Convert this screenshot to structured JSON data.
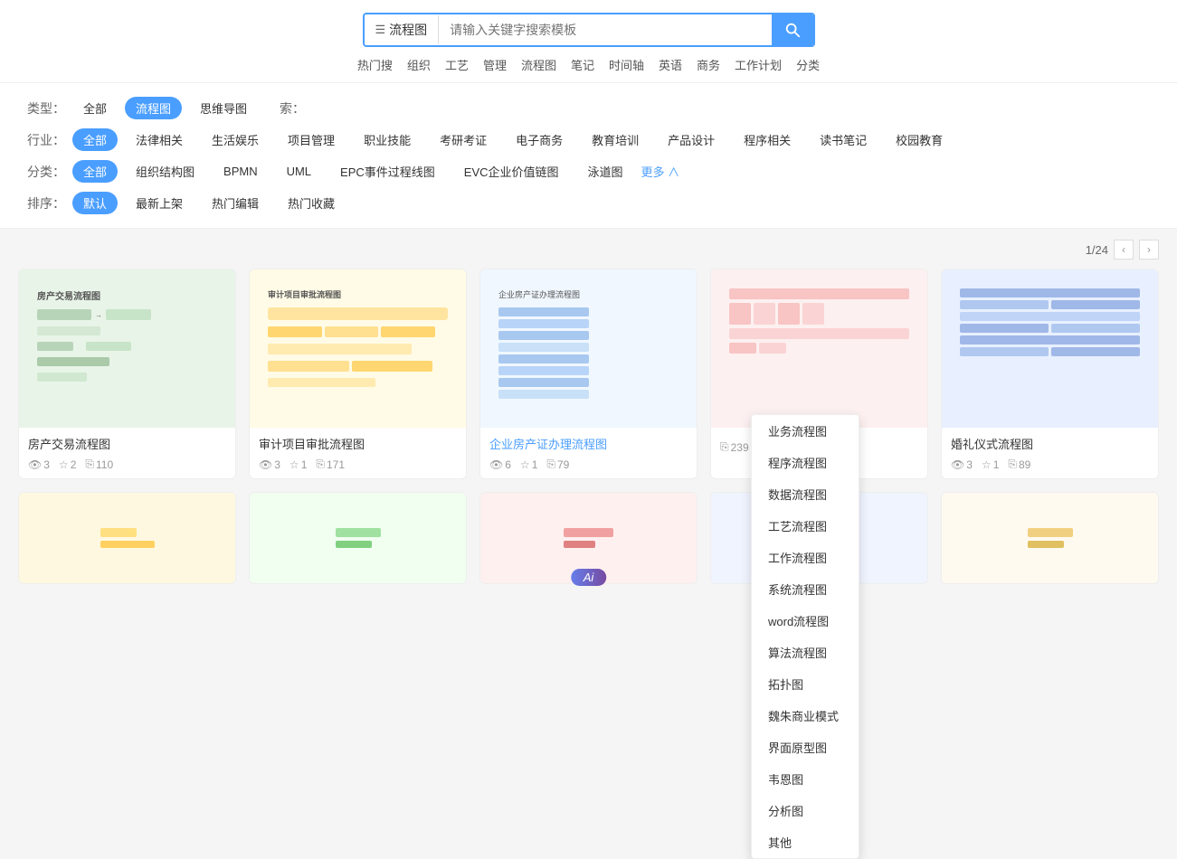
{
  "search": {
    "type_label": "流程图",
    "placeholder": "请输入关键字搜索模板",
    "button_label": "🔍"
  },
  "hot_tags": [
    "热门搜",
    "组织",
    "工艺",
    "管理",
    "流程图",
    "笔记",
    "时间轴",
    "英语",
    "商务",
    "工作计划",
    "分类"
  ],
  "filters": {
    "type_label": "类型：",
    "type_tags": [
      {
        "label": "全部",
        "active": false
      },
      {
        "label": "流程图",
        "active": true
      },
      {
        "label": "思维导图",
        "active": false
      }
    ],
    "search_label": "索：",
    "industry_label": "行业：",
    "industry_tags": [
      {
        "label": "全部",
        "active": true
      },
      {
        "label": "法律相关",
        "active": false
      },
      {
        "label": "生活娱乐",
        "active": false
      },
      {
        "label": "项目管理",
        "active": false
      },
      {
        "label": "职业技能",
        "active": false
      },
      {
        "label": "考研考证",
        "active": false
      },
      {
        "label": "电子商务",
        "active": false
      },
      {
        "label": "教育培训",
        "active": false
      },
      {
        "label": "产品设计",
        "active": false
      },
      {
        "label": "程序相关",
        "active": false
      },
      {
        "label": "读书笔记",
        "active": false
      },
      {
        "label": "校园教育",
        "active": false
      }
    ],
    "category_label": "分类：",
    "category_tags": [
      {
        "label": "全部",
        "active": true
      },
      {
        "label": "组织结构图",
        "active": false
      },
      {
        "label": "BPMN",
        "active": false
      },
      {
        "label": "UML",
        "active": false
      },
      {
        "label": "EPC事件过程线图",
        "active": false
      },
      {
        "label": "EVC企业价值链图",
        "active": false
      },
      {
        "label": "泳道图",
        "active": false
      }
    ],
    "more_label": "更多 ∧",
    "sort_label": "排序：",
    "sort_tags": [
      {
        "label": "默认",
        "active": true
      },
      {
        "label": "最新上架",
        "active": false
      },
      {
        "label": "热门编辑",
        "active": false
      },
      {
        "label": "热门收藏",
        "active": false
      }
    ]
  },
  "pagination": {
    "current": "1",
    "total": "24",
    "separator": "/"
  },
  "dropdown_items": [
    "业务流程图",
    "程序流程图",
    "数据流程图",
    "工艺流程图",
    "工作流程图",
    "系统流程图",
    "word流程图",
    "算法流程图",
    "拓扑图",
    "魏朱商业模式",
    "界面原型图",
    "韦恩图",
    "分析图",
    "其他"
  ],
  "cards": [
    {
      "title": "房产交易流程图",
      "title_blue": false,
      "views": "3",
      "stars": "2",
      "copies": "110",
      "bg": "#e8f4e8"
    },
    {
      "title": "审计项目审批流程图",
      "title_blue": false,
      "views": "3",
      "stars": "1",
      "copies": "171",
      "bg": "#fffbe6"
    },
    {
      "title": "企业房产证办理流程图",
      "title_blue": true,
      "views": "6",
      "stars": "1",
      "copies": "79",
      "bg": "#f0f7ff"
    },
    {
      "title": "",
      "title_blue": false,
      "views": "",
      "stars": "",
      "copies": "239",
      "bg": "#fdf0f0"
    },
    {
      "title": "婚礼仪式流程图",
      "title_blue": false,
      "views": "3",
      "stars": "1",
      "copies": "89",
      "bg": "#e8f0ff"
    }
  ],
  "bottom_cards": [
    {
      "bg": "#fff8e1",
      "title": ""
    },
    {
      "bg": "#f0fff0",
      "title": ""
    },
    {
      "bg": "#fff0f0",
      "title": ""
    },
    {
      "bg": "#f0f4ff",
      "title": ""
    },
    {
      "bg": "#fffaf0",
      "title": ""
    }
  ],
  "ai_label": "Ai"
}
